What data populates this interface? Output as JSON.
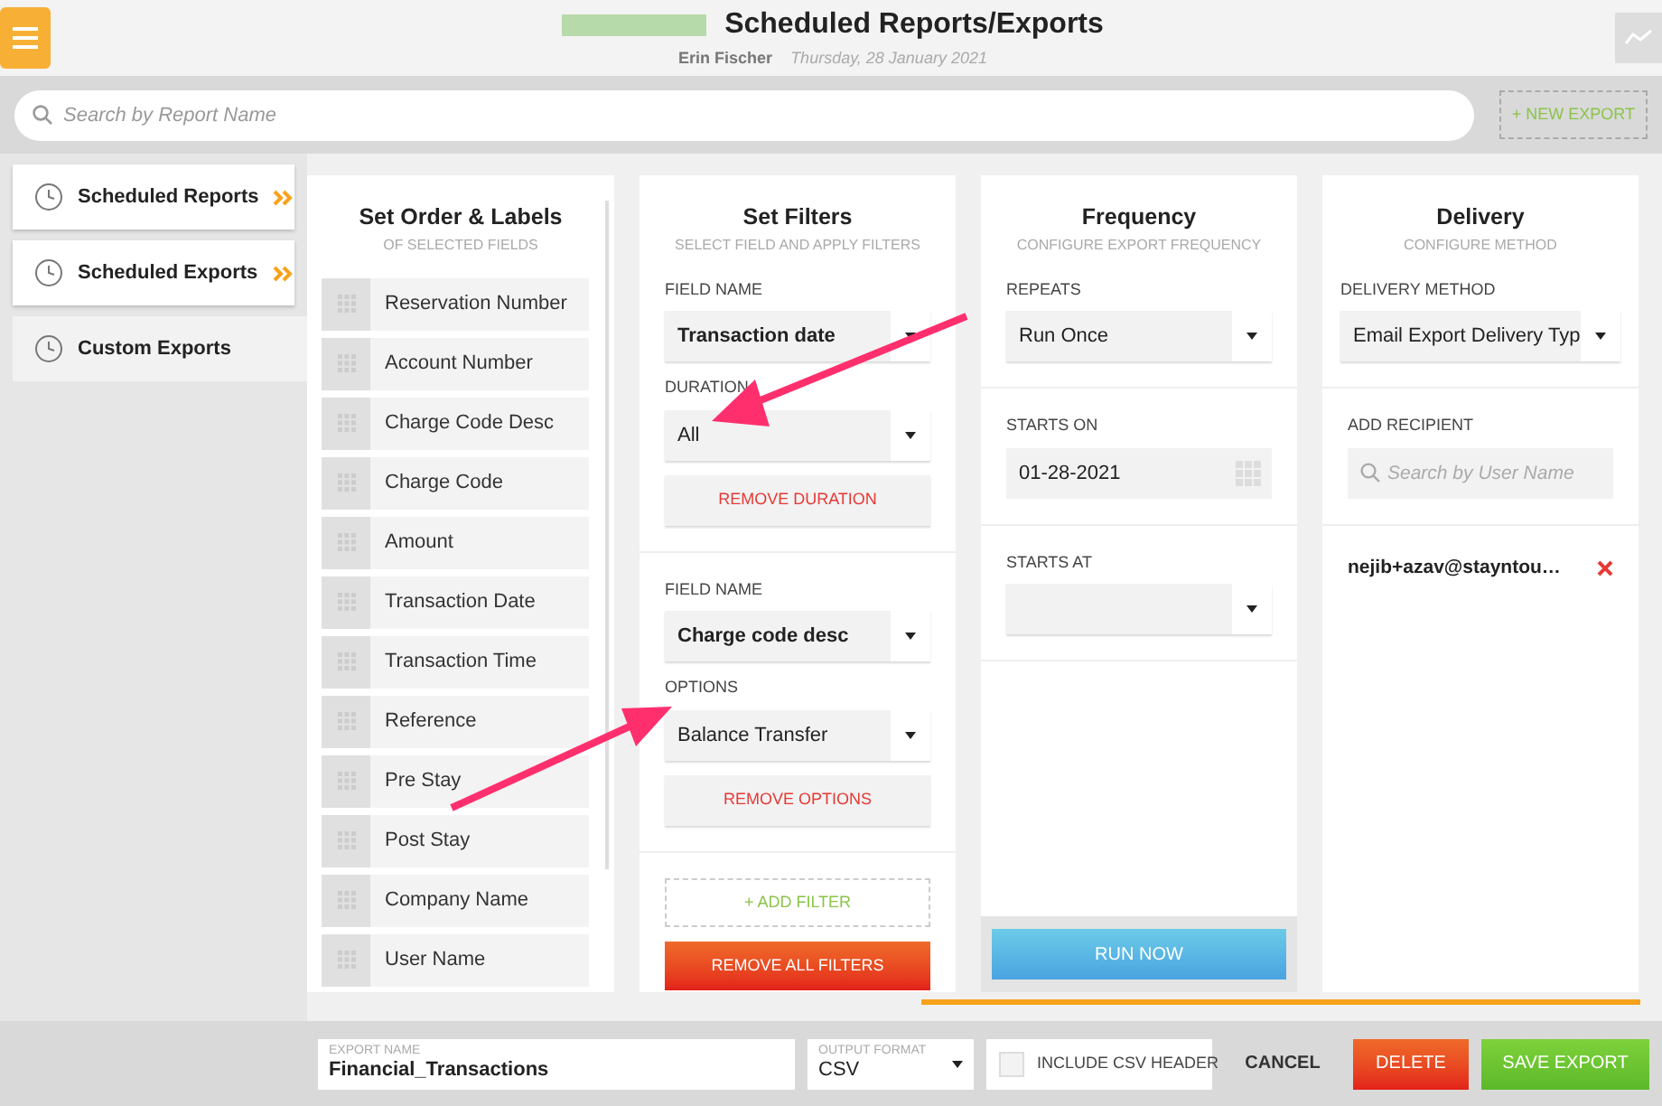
{
  "header": {
    "title": "Scheduled Reports/Exports",
    "user": "Erin Fischer",
    "date": "Thursday, 28 January 2021"
  },
  "search": {
    "placeholder": "Search by Report Name"
  },
  "new_export_button": "+ NEW EXPORT",
  "sidebar": {
    "items": [
      {
        "label": "Scheduled Reports",
        "selected": false,
        "chevron": true
      },
      {
        "label": "Scheduled Exports",
        "selected": false,
        "chevron": true
      },
      {
        "label": "Custom Exports",
        "selected": true,
        "chevron": false
      }
    ]
  },
  "order_panel": {
    "title": "Set Order & Labels",
    "subtitle": "OF SELECTED FIELDS",
    "fields": [
      "Reservation Number",
      "Account Number",
      "Charge Code Desc",
      "Charge Code",
      "Amount",
      "Transaction Date",
      "Transaction Time",
      "Reference",
      "Pre Stay",
      "Post Stay",
      "Company Name",
      "User Name"
    ]
  },
  "filters_panel": {
    "title": "Set Filters",
    "subtitle": "SELECT FIELD AND APPLY FILTERS",
    "filters": [
      {
        "field_label": "FIELD NAME",
        "field_value": "Transaction date",
        "sub_label": "DURATION",
        "sub_value": "All",
        "remove_button": "REMOVE DURATION"
      },
      {
        "field_label": "FIELD NAME",
        "field_value": "Charge code desc",
        "sub_label": "OPTIONS",
        "sub_value": "Balance Transfer",
        "remove_button": "REMOVE OPTIONS"
      }
    ],
    "add_filter_button": "+ ADD FILTER",
    "remove_all_button": "REMOVE ALL FILTERS"
  },
  "frequency_panel": {
    "title": "Frequency",
    "subtitle": "CONFIGURE EXPORT FREQUENCY",
    "repeats_label": "REPEATS",
    "repeats_value": "Run Once",
    "starts_on_label": "STARTS ON",
    "starts_on_value": "01-28-2021",
    "starts_at_label": "STARTS AT",
    "run_now_button": "RUN NOW"
  },
  "delivery_panel": {
    "title": "Delivery",
    "subtitle": "CONFIGURE METHOD",
    "method_label": "DELIVERY METHOD",
    "method_value": "Email Export Delivery Typ",
    "recipient_label": "ADD RECIPIENT",
    "recipient_placeholder": "Search by User Name",
    "recipients": [
      "nejib+azav@stayntou…"
    ]
  },
  "footer": {
    "export_name_label": "EXPORT NAME",
    "export_name_value": "Financial_Transactions",
    "format_label": "OUTPUT FORMAT",
    "format_value": "CSV",
    "csv_header": {
      "label": "INCLUDE CSV HEADER",
      "checked": false
    },
    "cancel_button": "CANCEL",
    "delete_button": "DELETE",
    "save_button": "SAVE EXPORT"
  }
}
